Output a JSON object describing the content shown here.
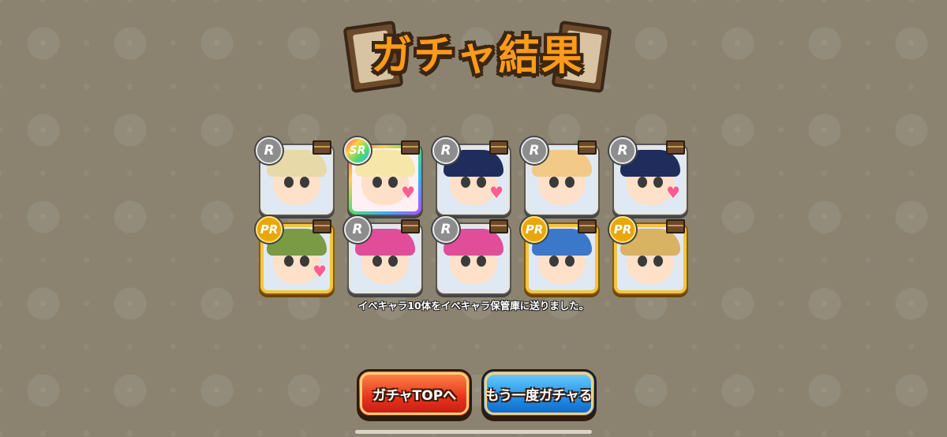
{
  "title": "ガチャ結果",
  "rows": [
    [
      {
        "rarity": "R",
        "frame": "silver",
        "hair": "#e8d9a8",
        "heart": false
      },
      {
        "rarity": "SR",
        "frame": "rainbow",
        "hair": "#f6e7a9",
        "heart": true
      },
      {
        "rarity": "R",
        "frame": "silver",
        "hair": "#1f2d5c",
        "heart": true
      },
      {
        "rarity": "R",
        "frame": "silver",
        "hair": "#f2c986",
        "heart": false
      },
      {
        "rarity": "R",
        "frame": "silver",
        "hair": "#1f2d5c",
        "heart": true
      }
    ],
    [
      {
        "rarity": "PR",
        "frame": "gold",
        "hair": "#7a9a45",
        "heart": true
      },
      {
        "rarity": "R",
        "frame": "silver",
        "hair": "#e24d9a",
        "heart": false
      },
      {
        "rarity": "R",
        "frame": "silver",
        "hair": "#e24d9a",
        "heart": false
      },
      {
        "rarity": "PR",
        "frame": "gold",
        "hair": "#3c78c9",
        "heart": false
      },
      {
        "rarity": "PR",
        "frame": "gold",
        "hair": "#d9b264",
        "heart": false
      }
    ]
  ],
  "message": "イベキャラ10体をイベキャラ保管庫に送りました。",
  "buttons": {
    "gacha_top": "ガチャTOPへ",
    "again": "もう一度ガチャる"
  },
  "colors": {
    "background": "#8b8370",
    "title": "#ff9a1a",
    "button_red": "#e8311c",
    "button_blue": "#1f8fe8"
  }
}
